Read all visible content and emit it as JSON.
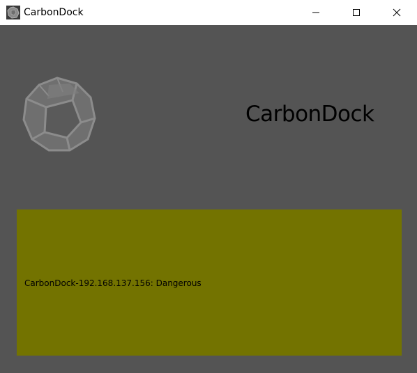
{
  "window": {
    "title": "CarbonDock",
    "icon": "carbondock-logo-icon",
    "controls": {
      "minimize": "minimize-icon",
      "maximize": "maximize-icon",
      "close": "close-icon"
    }
  },
  "main": {
    "heading": "CarbonDock",
    "logo_icon": "carbondock-logo-icon",
    "status": {
      "text": "CarbonDock-192.168.137.156: Dangerous",
      "color": "#737300"
    },
    "background_color": "#545454"
  }
}
